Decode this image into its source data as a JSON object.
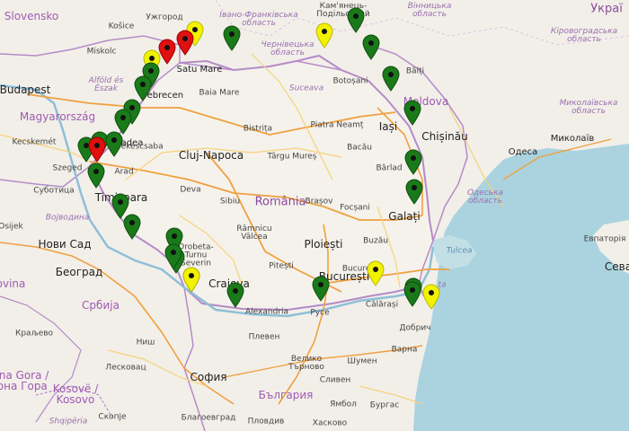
{
  "map": {
    "colors": {
      "land": "#f2efe9",
      "sea": "#aad3df",
      "border": "#b48cc8",
      "road_major": "#f0a040",
      "road_minor": "#f7d27a",
      "pin_green": "#1a7a1a",
      "pin_yellow": "#f2f200",
      "pin_red": "#e01010"
    },
    "labels": [
      {
        "id": "slovensko",
        "text": "Slovensko",
        "kind": "country"
      },
      {
        "id": "kosice",
        "text": "Košice",
        "kind": "city-sm"
      },
      {
        "id": "uzhorod",
        "text": "Ужгород",
        "kind": "city-sm"
      },
      {
        "id": "ivano",
        "text": "Івано-Франківська\nобласть",
        "kind": "region"
      },
      {
        "id": "kamianets",
        "text": "Кам'янець-\nПодільський",
        "kind": "city-sm"
      },
      {
        "id": "vinnytska",
        "text": "Вінницька\nобласть",
        "kind": "region"
      },
      {
        "id": "ukraina",
        "text": "Украї",
        "kind": "country-big"
      },
      {
        "id": "kirovohrad",
        "text": "Кіровоградська\nобласть",
        "kind": "region"
      },
      {
        "id": "miskolc",
        "text": "Miskolc",
        "kind": "city-sm"
      },
      {
        "id": "satu",
        "text": "Satu Mare",
        "kind": "city"
      },
      {
        "id": "chernivetska",
        "text": "Чернівецька\nобласть",
        "kind": "region"
      },
      {
        "id": "balti",
        "text": "Bălți",
        "kind": "city-sm"
      },
      {
        "id": "budapest",
        "text": "Budapest",
        "kind": "city-big"
      },
      {
        "id": "alfold",
        "text": "Alföld és\nÉszak",
        "kind": "region"
      },
      {
        "id": "baiamare",
        "text": "Baia Mare",
        "kind": "city-sm"
      },
      {
        "id": "suceava",
        "text": "Suceava",
        "kind": "region"
      },
      {
        "id": "botosani",
        "text": "Botoșani",
        "kind": "city-sm"
      },
      {
        "id": "moldova",
        "text": "Moldova",
        "kind": "country"
      },
      {
        "id": "mykolaivska",
        "text": "Миколаївська\nобласть",
        "kind": "region"
      },
      {
        "id": "debrecen",
        "text": "Debrecen",
        "kind": "city"
      },
      {
        "id": "magyar",
        "text": "Magyarország",
        "kind": "country"
      },
      {
        "id": "bistrita",
        "text": "Bistrița",
        "kind": "city-sm"
      },
      {
        "id": "piatra",
        "text": "Piatra Neamț",
        "kind": "city-sm"
      },
      {
        "id": "iasi",
        "text": "Iași",
        "kind": "city-big"
      },
      {
        "id": "chisinau",
        "text": "Chișinău",
        "kind": "city-big"
      },
      {
        "id": "mykolaiv",
        "text": "Миколаїв",
        "kind": "city"
      },
      {
        "id": "kecskemet",
        "text": "Kecskemét",
        "kind": "city-sm"
      },
      {
        "id": "oradea",
        "text": "Oradea",
        "kind": "city"
      },
      {
        "id": "bekescsaba",
        "text": "Békéscsaba",
        "kind": "city-sm"
      },
      {
        "id": "targu",
        "text": "Târgu Mureș",
        "kind": "city-sm"
      },
      {
        "id": "bacau",
        "text": "Bacău",
        "kind": "city-sm"
      },
      {
        "id": "cluj",
        "text": "Cluj-Napoca",
        "kind": "city-big"
      },
      {
        "id": "odesa",
        "text": "Одеса",
        "kind": "city"
      },
      {
        "id": "szeged",
        "text": "Szeged",
        "kind": "city-sm"
      },
      {
        "id": "arad",
        "text": "Arad",
        "kind": "city-sm"
      },
      {
        "id": "barlad",
        "text": "Bârlad",
        "kind": "city-sm"
      },
      {
        "id": "subotica",
        "text": "Суботица",
        "kind": "city-sm"
      },
      {
        "id": "timisoara",
        "text": "Timișoara",
        "kind": "city-big"
      },
      {
        "id": "deva",
        "text": "Deva",
        "kind": "city-sm"
      },
      {
        "id": "odeska",
        "text": "Одеська\nобласть",
        "kind": "region"
      },
      {
        "id": "romania",
        "text": "România",
        "kind": "country-big"
      },
      {
        "id": "sibiu",
        "text": "Sibiu",
        "kind": "city-sm"
      },
      {
        "id": "brasov",
        "text": "Brașov",
        "kind": "city-sm"
      },
      {
        "id": "focsani",
        "text": "Focșani",
        "kind": "city-sm"
      },
      {
        "id": "galati",
        "text": "Galați",
        "kind": "city-big"
      },
      {
        "id": "vojvodina",
        "text": "Војводина",
        "kind": "region"
      },
      {
        "id": "osijek",
        "text": "Osijek",
        "kind": "city-sm"
      },
      {
        "id": "ramnicu",
        "text": "Râmnicu\nVâlcea",
        "kind": "city-sm"
      },
      {
        "id": "ploiesti",
        "text": "Ploiești",
        "kind": "city-big"
      },
      {
        "id": "buzau",
        "text": "Buzău",
        "kind": "city-sm"
      },
      {
        "id": "tulcea",
        "text": "Tulcea",
        "kind": "sea"
      },
      {
        "id": "evpatoriia",
        "text": "Евпаторія",
        "kind": "city-sm"
      },
      {
        "id": "novisad",
        "text": "Нови Сад",
        "kind": "city-big"
      },
      {
        "id": "drobeta",
        "text": "Drobeta-\nTurnu\nSeverin",
        "kind": "city-sm"
      },
      {
        "id": "pitesti",
        "text": "Pitești",
        "kind": "city-sm"
      },
      {
        "id": "bucuresti",
        "text": "București",
        "kind": "city-big"
      },
      {
        "id": "sevastopol",
        "text": "Сева",
        "kind": "city-big"
      },
      {
        "id": "beograd",
        "text": "Београд",
        "kind": "city-big"
      },
      {
        "id": "vovina",
        "text": "ovina",
        "kind": "country"
      },
      {
        "id": "craiova",
        "text": "Craiova",
        "kind": "city-big"
      },
      {
        "id": "calarasi",
        "text": "Călărași",
        "kind": "city-sm"
      },
      {
        "id": "constanta",
        "text": "ța",
        "kind": "region"
      },
      {
        "id": "srbija",
        "text": "Србија",
        "kind": "country"
      },
      {
        "id": "alexandria",
        "text": "Alexandria",
        "kind": "city-sm"
      },
      {
        "id": "ruse",
        "text": "Русе",
        "kind": "city-sm"
      },
      {
        "id": "dobrich",
        "text": "Добрич",
        "kind": "city-sm"
      },
      {
        "id": "kraljevo",
        "text": "Краљево",
        "kind": "city-sm"
      },
      {
        "id": "pleven",
        "text": "Плевен",
        "kind": "city-sm"
      },
      {
        "id": "nis",
        "text": "Ниш",
        "kind": "city-sm"
      },
      {
        "id": "varna",
        "text": "Варна",
        "kind": "city-sm"
      },
      {
        "id": "veliko",
        "text": "Велико\nТърново",
        "kind": "city-sm"
      },
      {
        "id": "shumen",
        "text": "Шумен",
        "kind": "city-sm"
      },
      {
        "id": "crnagora",
        "text": "Crna Gora /\nЦрна Гора",
        "kind": "country"
      },
      {
        "id": "leskovac",
        "text": "Лесковац",
        "kind": "city-sm"
      },
      {
        "id": "sofia",
        "text": "София",
        "kind": "city-big"
      },
      {
        "id": "bulgaria",
        "text": "България",
        "kind": "country"
      },
      {
        "id": "kosovo",
        "text": "Kosovë /\nKosovo",
        "kind": "country"
      },
      {
        "id": "sliven",
        "text": "Сливен",
        "kind": "city-sm"
      },
      {
        "id": "yambol",
        "text": "Ямбол",
        "kind": "city-sm"
      },
      {
        "id": "burgas",
        "text": "Бургас",
        "kind": "city-sm"
      },
      {
        "id": "shqiperia",
        "text": "Shqipëria",
        "kind": "region"
      },
      {
        "id": "skopje",
        "text": "Скопје",
        "kind": "city-sm"
      },
      {
        "id": "blagoevgrad",
        "text": "Благоевград",
        "kind": "city-sm"
      },
      {
        "id": "plovdiv",
        "text": "Пловдив",
        "kind": "city-sm"
      },
      {
        "id": "haskovo",
        "text": "Хасково",
        "kind": "city-sm"
      },
      {
        "id": "bucuresti_ro",
        "text": "Bucureşti",
        "kind": "city-sm"
      }
    ],
    "markers": [
      {
        "id": "m1",
        "status": "yellow"
      },
      {
        "id": "m2",
        "status": "red"
      },
      {
        "id": "m3",
        "status": "red"
      },
      {
        "id": "m4",
        "status": "yellow"
      },
      {
        "id": "m5",
        "status": "green"
      },
      {
        "id": "m6",
        "status": "green"
      },
      {
        "id": "m7",
        "status": "green"
      },
      {
        "id": "m8",
        "status": "green"
      },
      {
        "id": "m9",
        "status": "green"
      },
      {
        "id": "m10",
        "status": "green"
      },
      {
        "id": "m11",
        "status": "red"
      },
      {
        "id": "m12",
        "status": "green"
      },
      {
        "id": "m13",
        "status": "green"
      },
      {
        "id": "m14",
        "status": "green"
      },
      {
        "id": "m15",
        "status": "green"
      },
      {
        "id": "m16",
        "status": "green"
      },
      {
        "id": "m17",
        "status": "green"
      },
      {
        "id": "m18",
        "status": "green"
      },
      {
        "id": "m19",
        "status": "green"
      },
      {
        "id": "m20",
        "status": "yellow"
      },
      {
        "id": "m21",
        "status": "green"
      },
      {
        "id": "m22",
        "status": "green"
      },
      {
        "id": "m23",
        "status": "green"
      },
      {
        "id": "m24",
        "status": "yellow"
      },
      {
        "id": "m25",
        "status": "green"
      },
      {
        "id": "m26",
        "status": "green"
      },
      {
        "id": "m27",
        "status": "green"
      },
      {
        "id": "m28",
        "status": "green"
      },
      {
        "id": "m29",
        "status": "green"
      },
      {
        "id": "m30",
        "status": "green"
      },
      {
        "id": "m31",
        "status": "yellow"
      },
      {
        "id": "m32",
        "status": "green"
      },
      {
        "id": "m33",
        "status": "yellow"
      },
      {
        "id": "m34",
        "status": "green"
      }
    ]
  }
}
